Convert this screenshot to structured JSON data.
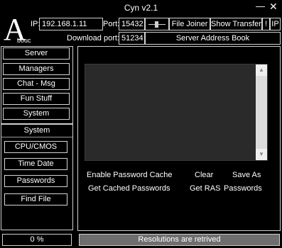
{
  "window": {
    "title": "Cyn v2.1",
    "minimize_glyph": "—",
    "close_glyph": "✕"
  },
  "logo": {
    "big": "A",
    "small": "bouc"
  },
  "connection": {
    "ip_label": "IP:",
    "ip_value": "192.168.1.11",
    "port_label": "Port:",
    "port_value": "15432",
    "download_port_label": "Download port:",
    "download_port_value": "51234"
  },
  "toolbar": {
    "file_joiner": "File Joiner",
    "show_transfer": "Show Transfer",
    "exclaim": "!",
    "ip": "IP",
    "server_address_book": "Server Address Book"
  },
  "sidebar": {
    "items": [
      {
        "label": "Server"
      },
      {
        "label": "Managers"
      },
      {
        "label": "Chat - Msg"
      },
      {
        "label": "Fun Stuff"
      },
      {
        "label": "System"
      }
    ]
  },
  "subpanel": {
    "title": "System",
    "items": [
      {
        "label": "CPU/CMOS"
      },
      {
        "label": "Time Date"
      },
      {
        "label": "Passwords"
      },
      {
        "label": "Find File"
      }
    ]
  },
  "actions": {
    "enable_password_cache": "Enable Password Cache",
    "clear": "Clear",
    "save_as": "Save As",
    "get_cached_passwords": "Get Cached Passwords",
    "get_ras": "Get RAS",
    "passwords": "Passwords"
  },
  "status": {
    "progress": "0 %",
    "message": "Resolutions are retrived"
  },
  "colors": {
    "background": "#000000",
    "text": "#ffffff",
    "border": "#cfcfcf",
    "output_area": "#2a2a2a",
    "status_message_bg": "#6e6e6e"
  }
}
